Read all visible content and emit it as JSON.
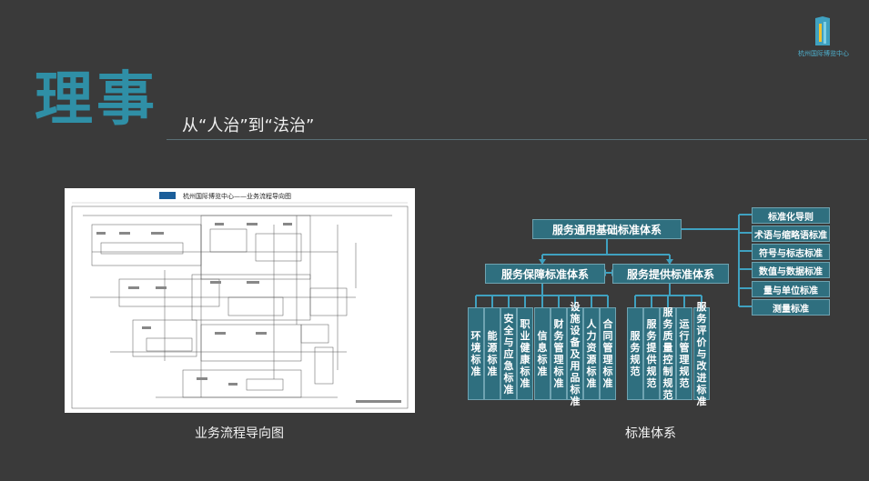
{
  "header": {
    "title": "理事",
    "subtitle": "从“人治”到“法治”",
    "logo_text": "杭州国际博览中心"
  },
  "flow_doc": {
    "heading": "杭州国际博览中心——业务流程导向图",
    "caption": "业务流程导向图"
  },
  "standards": {
    "caption": "标准体系",
    "root": "服务通用基础标准体系",
    "branch_left": "服务保障标准体系",
    "branch_right": "服务提供标准体系",
    "left_leaves": [
      "环境标准",
      "能源标准",
      "安全与应急标准",
      "职业健康标准",
      "信息标准",
      "财务管理标准",
      "设施设备及用品标准",
      "人力资源标准",
      "合同管理标准"
    ],
    "right_leaves": [
      "服务规范",
      "服务提供规范",
      "服务质量控制规范",
      "运行管理规范",
      "服务评价与改进标准"
    ],
    "basic_items": [
      "标准化导则",
      "术语与缩略语标准",
      "符号与标志标准",
      "数值与数据标准",
      "量与单位标准",
      "测量标准"
    ]
  },
  "colors": {
    "accent": "#2f8fa6",
    "box": "#2f6f7f",
    "connector": "#3fa1c0",
    "background": "#3a3a3a"
  }
}
